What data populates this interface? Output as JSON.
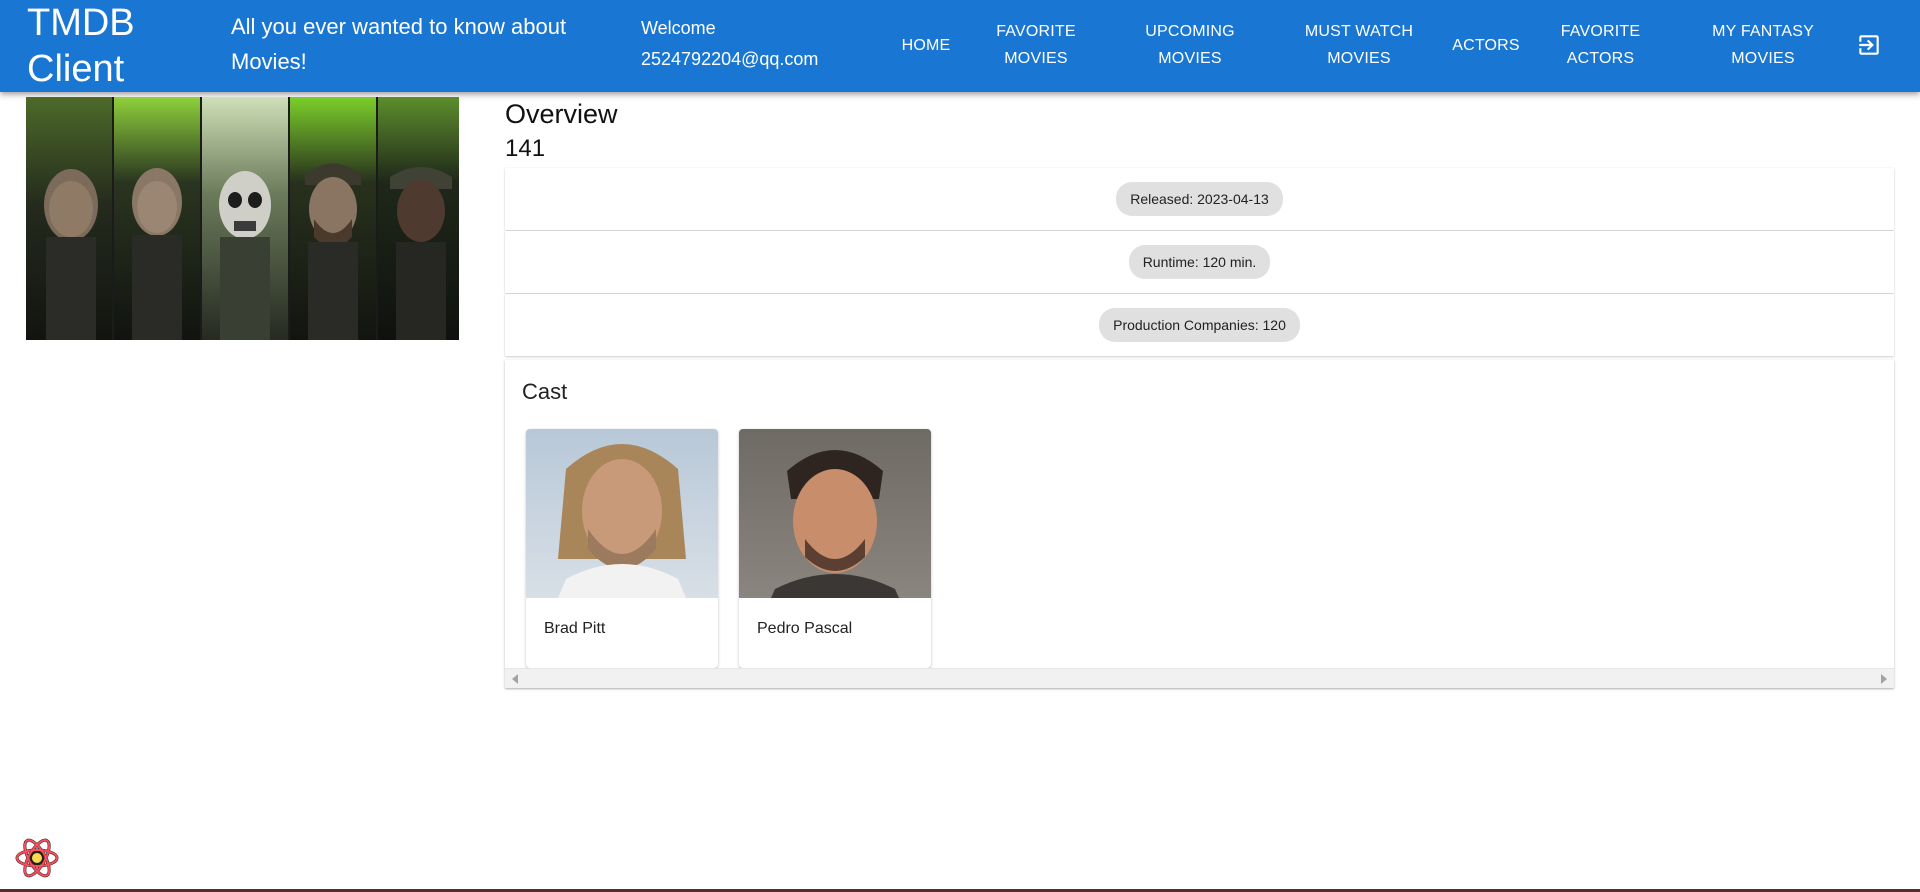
{
  "header": {
    "brand": "TMDB Client",
    "tagline": "All you ever wanted to know about Movies!",
    "welcome_label": "Welcome",
    "user_email": "2524792204@qq.com",
    "nav": [
      {
        "label": "HOME"
      },
      {
        "label": "FAVORITE MOVIES"
      },
      {
        "label": "UPCOMING MOVIES"
      },
      {
        "label": "MUST WATCH MOVIES"
      },
      {
        "label": "ACTORS"
      },
      {
        "label": "FAVORITE ACTORS"
      },
      {
        "label": "MY FANTASY MOVIES"
      }
    ],
    "logout_icon": "logout-icon"
  },
  "movie": {
    "overview_title": "Overview",
    "overview_text": "141",
    "chips": [
      {
        "label": "Released: 2023-04-13"
      },
      {
        "label": "Runtime: 120 min."
      },
      {
        "label": "Production Companies: 120"
      }
    ]
  },
  "cast": {
    "title": "Cast",
    "members": [
      {
        "name": "Brad Pitt"
      },
      {
        "name": "Pedro Pascal"
      }
    ]
  },
  "colors": {
    "appbar": "#1976d2",
    "chip": "#e0e0e0",
    "poster_accent": "#7ccf2a"
  }
}
